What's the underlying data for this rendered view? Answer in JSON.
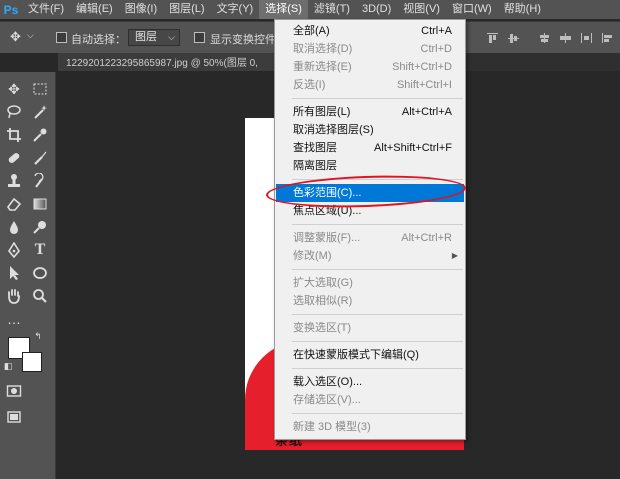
{
  "app": {
    "logo": "Ps",
    "accent_color": "#31a8ff"
  },
  "menubar": {
    "items": [
      {
        "label": "文件(F)"
      },
      {
        "label": "编辑(E)"
      },
      {
        "label": "图像(I)"
      },
      {
        "label": "图层(L)"
      },
      {
        "label": "文字(Y)"
      },
      {
        "label": "选择(S)",
        "active": true
      },
      {
        "label": "滤镜(T)"
      },
      {
        "label": "3D(D)"
      },
      {
        "label": "视图(V)"
      },
      {
        "label": "窗口(W)"
      },
      {
        "label": "帮助(H)"
      }
    ]
  },
  "options": {
    "auto_select_label": "自动选择：",
    "layer_select_value": "图层",
    "show_transform_label": "显示变换控件",
    "auto_select_checked": false,
    "show_transform_checked": false
  },
  "document": {
    "tab_title": "1229201223295865987.jpg @ 50%(图层 0,"
  },
  "canvas": {
    "shirt_color": "#e51f2b",
    "shirt_text": "条纸"
  },
  "select_menu": {
    "highlight_color": "#0078d7",
    "annotation_color": "#e0141e",
    "items": [
      {
        "label": "全部(A)",
        "shortcut": "Ctrl+A",
        "disabled": false
      },
      {
        "label": "取消选择(D)",
        "shortcut": "Ctrl+D",
        "disabled": true
      },
      {
        "label": "重新选择(E)",
        "shortcut": "Shift+Ctrl+D",
        "disabled": true
      },
      {
        "label": "反选(I)",
        "shortcut": "Shift+Ctrl+I",
        "disabled": true
      },
      {
        "label": "所有图层(L)",
        "shortcut": "Alt+Ctrl+A",
        "disabled": false
      },
      {
        "label": "取消选择图层(S)",
        "shortcut": "",
        "disabled": false
      },
      {
        "label": "查找图层",
        "shortcut": "Alt+Shift+Ctrl+F",
        "disabled": false
      },
      {
        "label": "隔离图层",
        "shortcut": "",
        "disabled": false
      },
      {
        "label": "色彩范围(C)...",
        "shortcut": "",
        "disabled": false,
        "highlighted": true
      },
      {
        "label": "焦点区域(U)...",
        "shortcut": "",
        "disabled": false
      },
      {
        "label": "调整蒙版(F)...",
        "shortcut": "Alt+Ctrl+R",
        "disabled": true
      },
      {
        "label": "修改(M)",
        "shortcut": "",
        "disabled": true,
        "submenu": true
      },
      {
        "label": "扩大选取(G)",
        "shortcut": "",
        "disabled": true
      },
      {
        "label": "选取相似(R)",
        "shortcut": "",
        "disabled": true
      },
      {
        "label": "变换选区(T)",
        "shortcut": "",
        "disabled": true
      },
      {
        "label": "在快速蒙版模式下编辑(Q)",
        "shortcut": "",
        "disabled": false
      },
      {
        "label": "载入选区(O)...",
        "shortcut": "",
        "disabled": false
      },
      {
        "label": "存储选区(V)...",
        "shortcut": "",
        "disabled": true
      },
      {
        "label": "新建 3D 模型(3)",
        "shortcut": "",
        "disabled": true
      }
    ]
  }
}
